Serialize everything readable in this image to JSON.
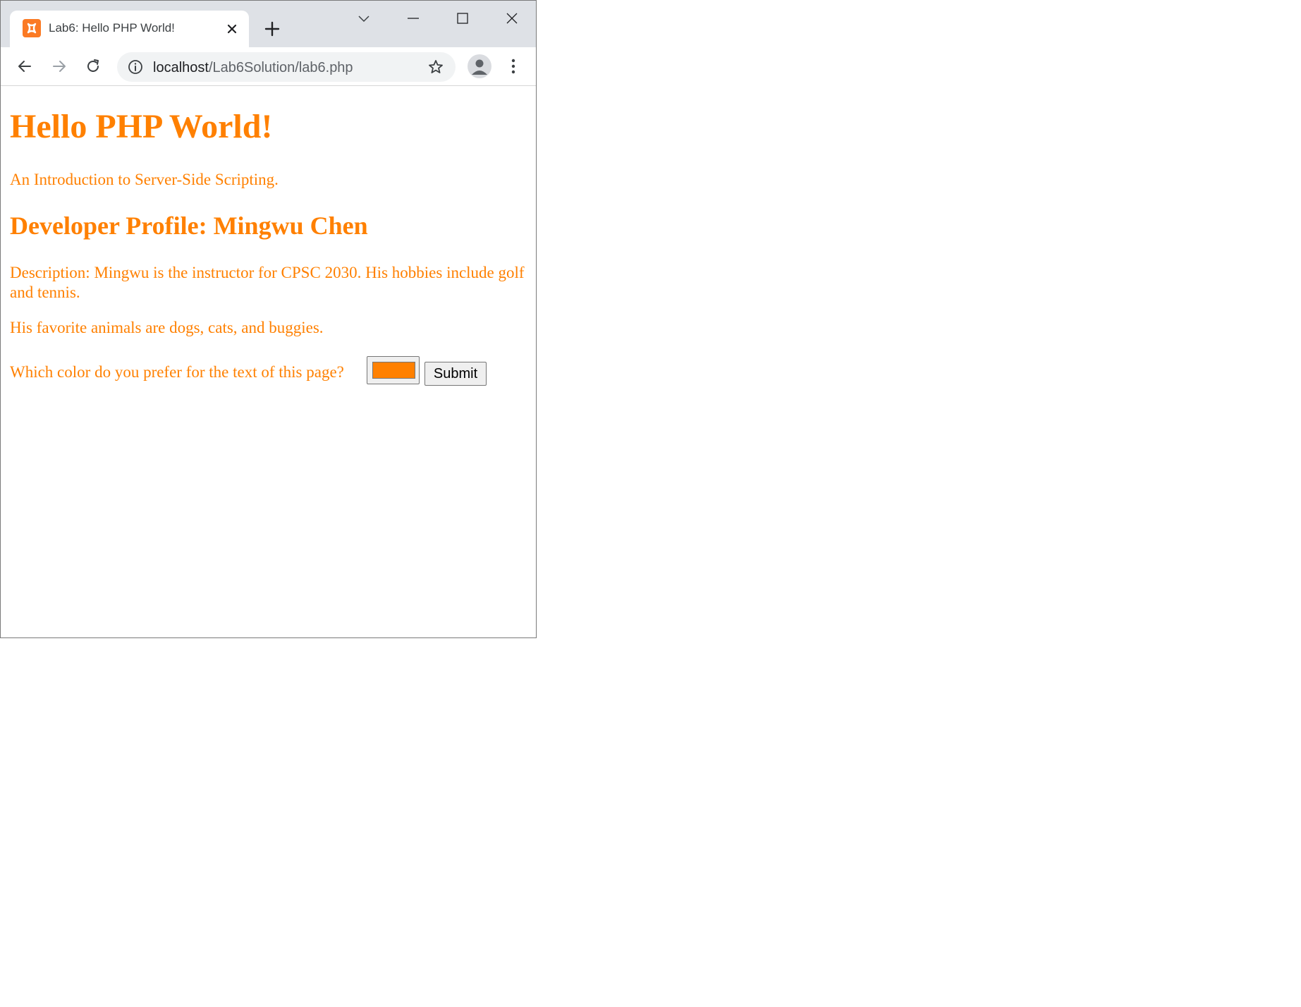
{
  "browser": {
    "tab": {
      "title": "Lab6: Hello PHP World!",
      "favicon": "xampp-icon"
    },
    "url": {
      "host": "localhost",
      "path": "/Lab6Solution/lab6.php"
    }
  },
  "page": {
    "text_color": "#ff8000",
    "heading": "Hello PHP World!",
    "intro": "An Introduction to Server-Side Scripting.",
    "profile_heading": "Developer Profile: Mingwu Chen",
    "description": "Description: Mingwu is the instructor for CPSC 2030. His hobbies include golf and tennis.",
    "animals": "His favorite animals are dogs, cats, and buggies.",
    "color_question": "Which color do you prefer for the text of this page?",
    "color_value": "#ff8000",
    "submit_label": "Submit"
  }
}
